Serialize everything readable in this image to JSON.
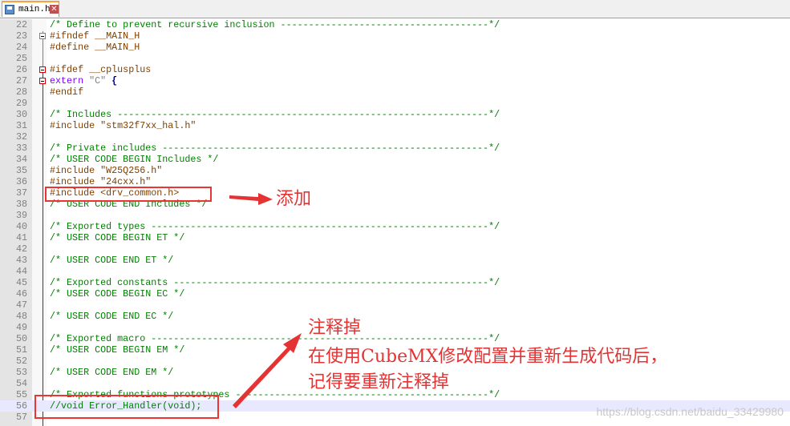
{
  "tab": {
    "filename": "main.h",
    "icon": "save-icon",
    "close_icon": "close-icon"
  },
  "lines": [
    {
      "n": "22",
      "t": [
        [
          "c",
          "/* Define to prevent recursive inclusion -------------------------------------*/"
        ]
      ]
    },
    {
      "n": "23",
      "t": [
        [
          "p",
          "#ifndef __MAIN_H"
        ]
      ]
    },
    {
      "n": "24",
      "t": [
        [
          "p",
          "#define __MAIN_H"
        ]
      ]
    },
    {
      "n": "25",
      "t": []
    },
    {
      "n": "26",
      "t": [
        [
          "p",
          "#ifdef __cplusplus"
        ]
      ]
    },
    {
      "n": "27",
      "t": [
        [
          "k",
          "extern"
        ],
        [
          "n",
          " "
        ],
        [
          "s",
          "\"C\""
        ],
        [
          "n",
          " "
        ],
        [
          "o",
          "{"
        ]
      ]
    },
    {
      "n": "28",
      "t": [
        [
          "p",
          "#endif"
        ]
      ]
    },
    {
      "n": "29",
      "t": []
    },
    {
      "n": "30",
      "t": [
        [
          "c",
          "/* Includes ------------------------------------------------------------------*/"
        ]
      ]
    },
    {
      "n": "31",
      "t": [
        [
          "p",
          "#include \"stm32f7xx_hal.h\""
        ]
      ]
    },
    {
      "n": "32",
      "t": []
    },
    {
      "n": "33",
      "t": [
        [
          "c",
          "/* Private includes ----------------------------------------------------------*/"
        ]
      ]
    },
    {
      "n": "34",
      "t": [
        [
          "c",
          "/* USER CODE BEGIN Includes */"
        ]
      ]
    },
    {
      "n": "35",
      "t": [
        [
          "p",
          "#include \"W25Q256.h\""
        ]
      ]
    },
    {
      "n": "36",
      "t": [
        [
          "p",
          "#include \"24cxx.h\""
        ]
      ]
    },
    {
      "n": "37",
      "t": [
        [
          "p",
          "#include <drv_common.h>"
        ]
      ]
    },
    {
      "n": "38",
      "t": [
        [
          "c",
          "/* USER CODE END Includes */"
        ]
      ]
    },
    {
      "n": "39",
      "t": []
    },
    {
      "n": "40",
      "t": [
        [
          "c",
          "/* Exported types ------------------------------------------------------------*/"
        ]
      ]
    },
    {
      "n": "41",
      "t": [
        [
          "c",
          "/* USER CODE BEGIN ET */"
        ]
      ]
    },
    {
      "n": "42",
      "t": []
    },
    {
      "n": "43",
      "t": [
        [
          "c",
          "/* USER CODE END ET */"
        ]
      ]
    },
    {
      "n": "44",
      "t": []
    },
    {
      "n": "45",
      "t": [
        [
          "c",
          "/* Exported constants --------------------------------------------------------*/"
        ]
      ]
    },
    {
      "n": "46",
      "t": [
        [
          "c",
          "/* USER CODE BEGIN EC */"
        ]
      ]
    },
    {
      "n": "47",
      "t": []
    },
    {
      "n": "48",
      "t": [
        [
          "c",
          "/* USER CODE END EC */"
        ]
      ]
    },
    {
      "n": "49",
      "t": []
    },
    {
      "n": "50",
      "t": [
        [
          "c",
          "/* Exported macro ------------------------------------------------------------*/"
        ]
      ]
    },
    {
      "n": "51",
      "t": [
        [
          "c",
          "/* USER CODE BEGIN EM */"
        ]
      ]
    },
    {
      "n": "52",
      "t": []
    },
    {
      "n": "53",
      "t": [
        [
          "c",
          "/* USER CODE END EM */"
        ]
      ]
    },
    {
      "n": "54",
      "t": []
    },
    {
      "n": "55",
      "t": [
        [
          "c",
          "/* Exported functions prototypes ---------------------------------------------*/"
        ]
      ]
    },
    {
      "n": "56",
      "t": [
        [
          "c",
          "//void Error_Handler(void);"
        ]
      ]
    },
    {
      "n": "57",
      "t": []
    }
  ],
  "current_line": "56",
  "annotations": {
    "add": "添加",
    "comment_out": "注释掉",
    "note_line1": "在使用CubeMX修改配置并重新生成代码后，",
    "note_line2": "记得要重新注释掉",
    "color": "#e53333"
  },
  "watermark": "https://blog.csdn.net/baidu_33429980"
}
